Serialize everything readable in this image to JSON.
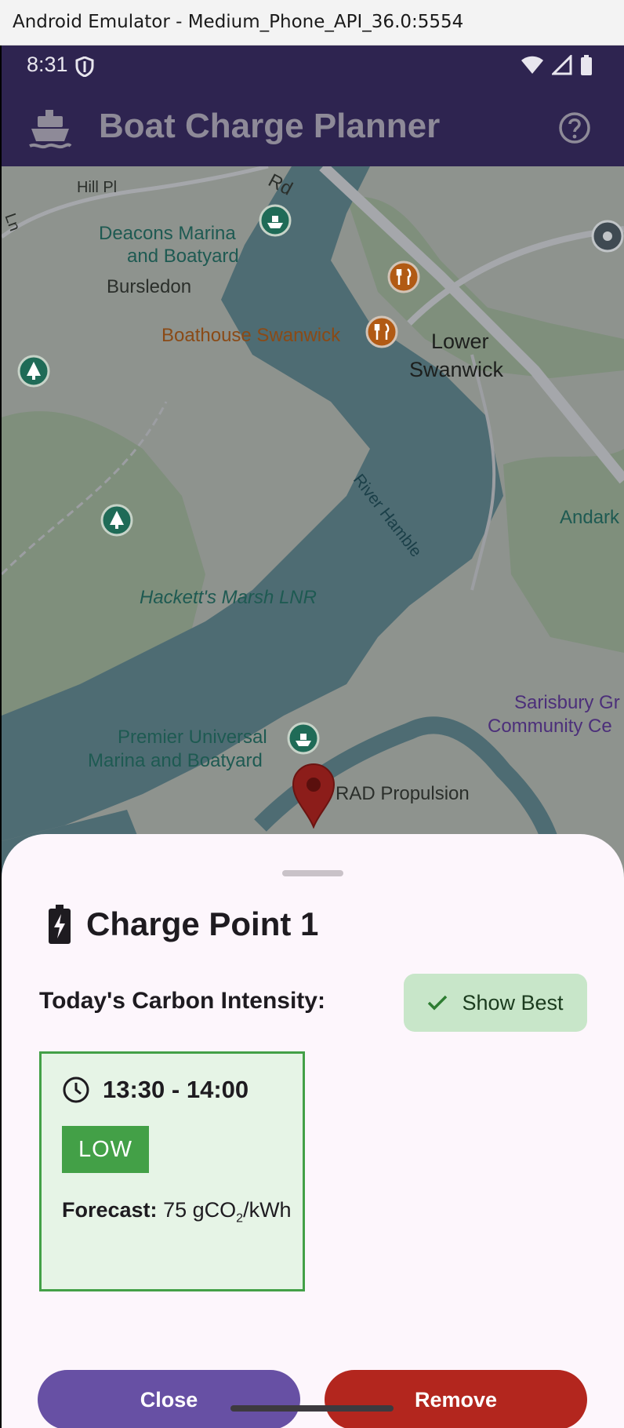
{
  "emulator": {
    "title": "Android Emulator - Medium_Phone_API_36.0:5554"
  },
  "status_bar": {
    "time": "8:31"
  },
  "app_bar": {
    "title": "Boat Charge Planner",
    "ship_icon": "ship-icon",
    "help_icon": "help-circle-icon"
  },
  "map": {
    "labels": {
      "hill_pl": "Hill Pl",
      "rd": "Rd",
      "ln": "Ln",
      "deacons_1": "Deacons Marina",
      "deacons_2": "and Boatyard",
      "bursledon": "Bursledon",
      "boathouse": "Boathouse Swanwick",
      "lower": "Lower",
      "swanwick": "Swanwick",
      "river": "River Hamble",
      "andark": "Andark",
      "hackett": "Hackett's Marsh LNR",
      "sarisbury_1": "Sarisbury Gr",
      "sarisbury_2": "Community Ce",
      "premier_1": "Premier Universal",
      "premier_2": "Marina and Boatyard",
      "rad": "RAD Propulsion"
    },
    "colors": {
      "water": "#4e6c73",
      "land": "#8e938e",
      "green": "#7f8f7c",
      "road": "#a5a7ab"
    }
  },
  "sheet": {
    "title": "Charge Point 1",
    "title_icon": "battery-charging-icon",
    "carbon_label": "Today's Carbon Intensity:",
    "show_best_label": "Show Best",
    "slot": {
      "time": "13:30 - 14:00",
      "level": "LOW",
      "forecast_label": "Forecast:",
      "forecast_value": "75",
      "unit_pre": "gCO",
      "unit_sub": "2",
      "unit_post": "/kWh"
    },
    "close_label": "Close",
    "remove_label": "Remove"
  },
  "colors": {
    "primary": "#6750a4",
    "danger": "#b3261e",
    "low": "#43a047",
    "appbar": "#2e2450"
  }
}
